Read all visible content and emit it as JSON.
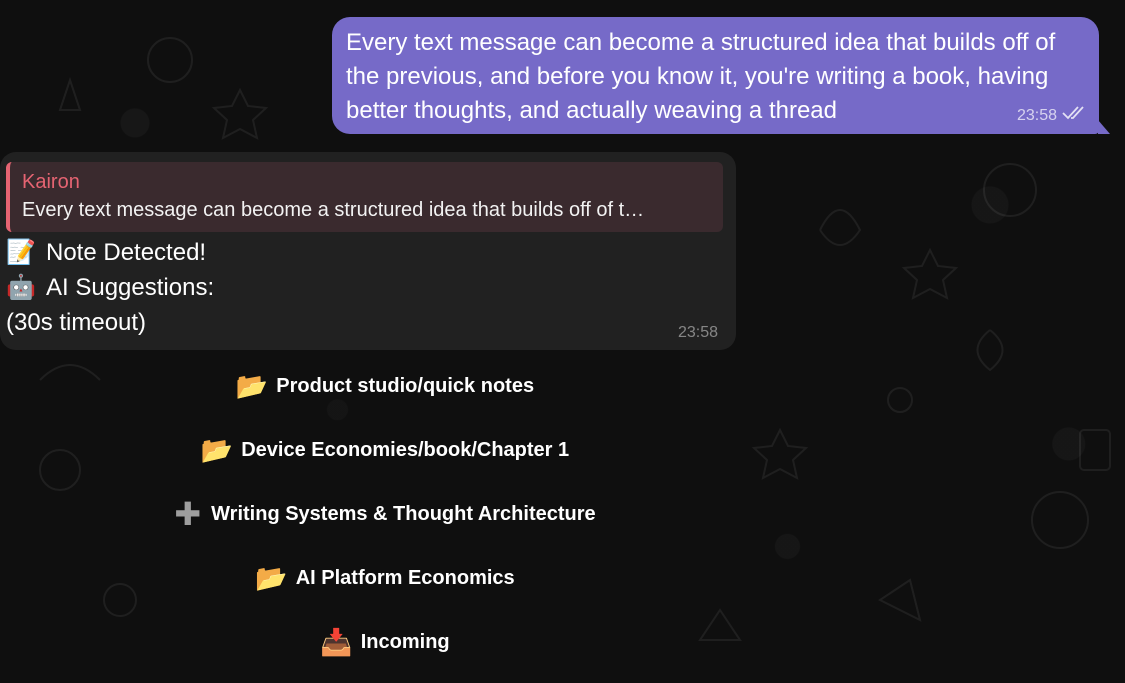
{
  "outgoing_message": {
    "text": "Every text message can become a structured idea that builds off of the previous, and before you know it, you're writing a book, having better thoughts, and actually weaving a thread",
    "time": "23:58",
    "status_icon": "double-check-icon"
  },
  "incoming_message": {
    "reply": {
      "author": "Kairon",
      "quote": "Every text message can become a structured idea that builds off of t…"
    },
    "lines": [
      {
        "emoji": "📝",
        "text": "Note Detected!"
      },
      {
        "emoji": "🤖",
        "text": "AI Suggestions:"
      },
      {
        "emoji": "",
        "text": "(30s timeout)"
      }
    ],
    "time": "23:58"
  },
  "keyboard": {
    "buttons": [
      {
        "icon": "folder-icon",
        "glyph": "📂",
        "label": "Product studio/quick notes"
      },
      {
        "icon": "folder-icon",
        "glyph": "📂",
        "label": "Device Economies/book/Chapter 1"
      },
      {
        "icon": "plus-icon",
        "glyph": "✚",
        "label": "Writing Systems & Thought Architecture"
      },
      {
        "icon": "folder-icon",
        "glyph": "📂",
        "label": "AI Platform Economics"
      },
      {
        "icon": "inbox-icon",
        "glyph": "📥",
        "label": "Incoming"
      }
    ]
  },
  "colors": {
    "background": "#0f0f0f",
    "outgoing_bubble": "#766ac8",
    "incoming_bubble": "#212121",
    "reply_accent": "#e56472"
  }
}
